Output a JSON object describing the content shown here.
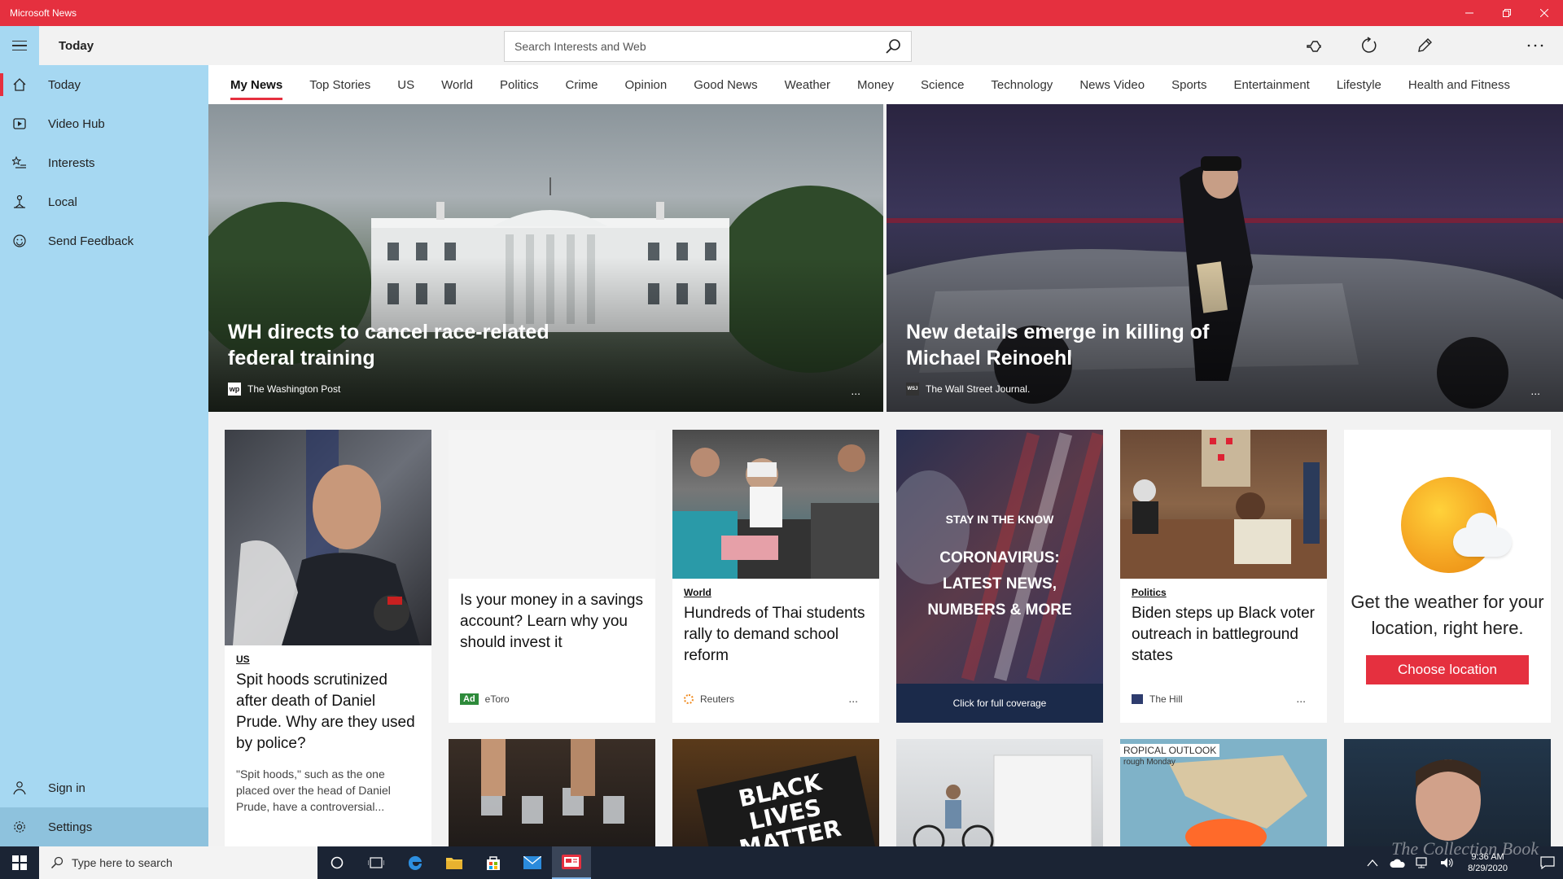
{
  "window": {
    "title": "Microsoft News"
  },
  "header": {
    "page_title": "Today",
    "search_placeholder": "Search Interests and Web"
  },
  "sidebar": {
    "items": [
      {
        "label": "Today",
        "icon": "home-icon"
      },
      {
        "label": "Video Hub",
        "icon": "video-icon"
      },
      {
        "label": "Interests",
        "icon": "star-list-icon"
      },
      {
        "label": "Local",
        "icon": "location-person-icon"
      },
      {
        "label": "Send Feedback",
        "icon": "smiley-icon"
      }
    ],
    "bottom": [
      {
        "label": "Sign in",
        "icon": "person-icon"
      },
      {
        "label": "Settings",
        "icon": "gear-icon"
      }
    ]
  },
  "tabs": [
    "My News",
    "Top Stories",
    "US",
    "World",
    "Politics",
    "Crime",
    "Opinion",
    "Good News",
    "Weather",
    "Money",
    "Science",
    "Technology",
    "News Video",
    "Sports",
    "Entertainment",
    "Lifestyle",
    "Health and Fitness"
  ],
  "hero": [
    {
      "title": "WH directs to cancel race-related federal training",
      "source": "The Washington Post",
      "logo": "wp",
      "more": "..."
    },
    {
      "title": "New details emerge in killing of Michael Reinoehl",
      "source": "The Wall Street Journal.",
      "logo": "WSJ",
      "more": "..."
    }
  ],
  "cards": {
    "spit_hoods": {
      "category": "US",
      "title": "Spit hoods scrutinized after death of Daniel Prude. Why are they used by police?",
      "excerpt": "\"Spit hoods,\" such as the one placed over the head of Daniel Prude, have a controversial..."
    },
    "etoro": {
      "title": "Is your money in a savings account? Learn why you should invest it",
      "ad_label": "Ad",
      "source": "eToro"
    },
    "thai": {
      "category": "World",
      "title": "Hundreds of Thai students rally to demand school reform",
      "source": "Reuters",
      "more": "..."
    },
    "corona": {
      "kicker": "STAY IN THE KNOW",
      "headline_1": "CORONAVIRUS:",
      "headline_2": "LATEST NEWS,",
      "headline_3": "NUMBERS & MORE",
      "cta": "Click for full coverage"
    },
    "biden": {
      "category": "Politics",
      "title": "Biden steps up Black voter outreach in battleground states",
      "source": "The Hill",
      "more": "..."
    },
    "weather": {
      "text": "Get the weather for your location, right here.",
      "button": "Choose location"
    },
    "row2": {
      "blm_sign_1": "BLACK",
      "blm_sign_2": "LIVES",
      "blm_sign_3": "MATTER",
      "map_label_1": "ROPICAL OUTLOOK",
      "map_label_2": "rough Monday"
    }
  },
  "taskbar": {
    "search_placeholder": "Type here to search",
    "time": "9:36 AM",
    "date": "8/29/2020"
  },
  "watermark": "The Collection Book",
  "colors": {
    "accent": "#e5303f",
    "sidebar": "#a6d8f2",
    "taskbar": "#1b2434"
  }
}
